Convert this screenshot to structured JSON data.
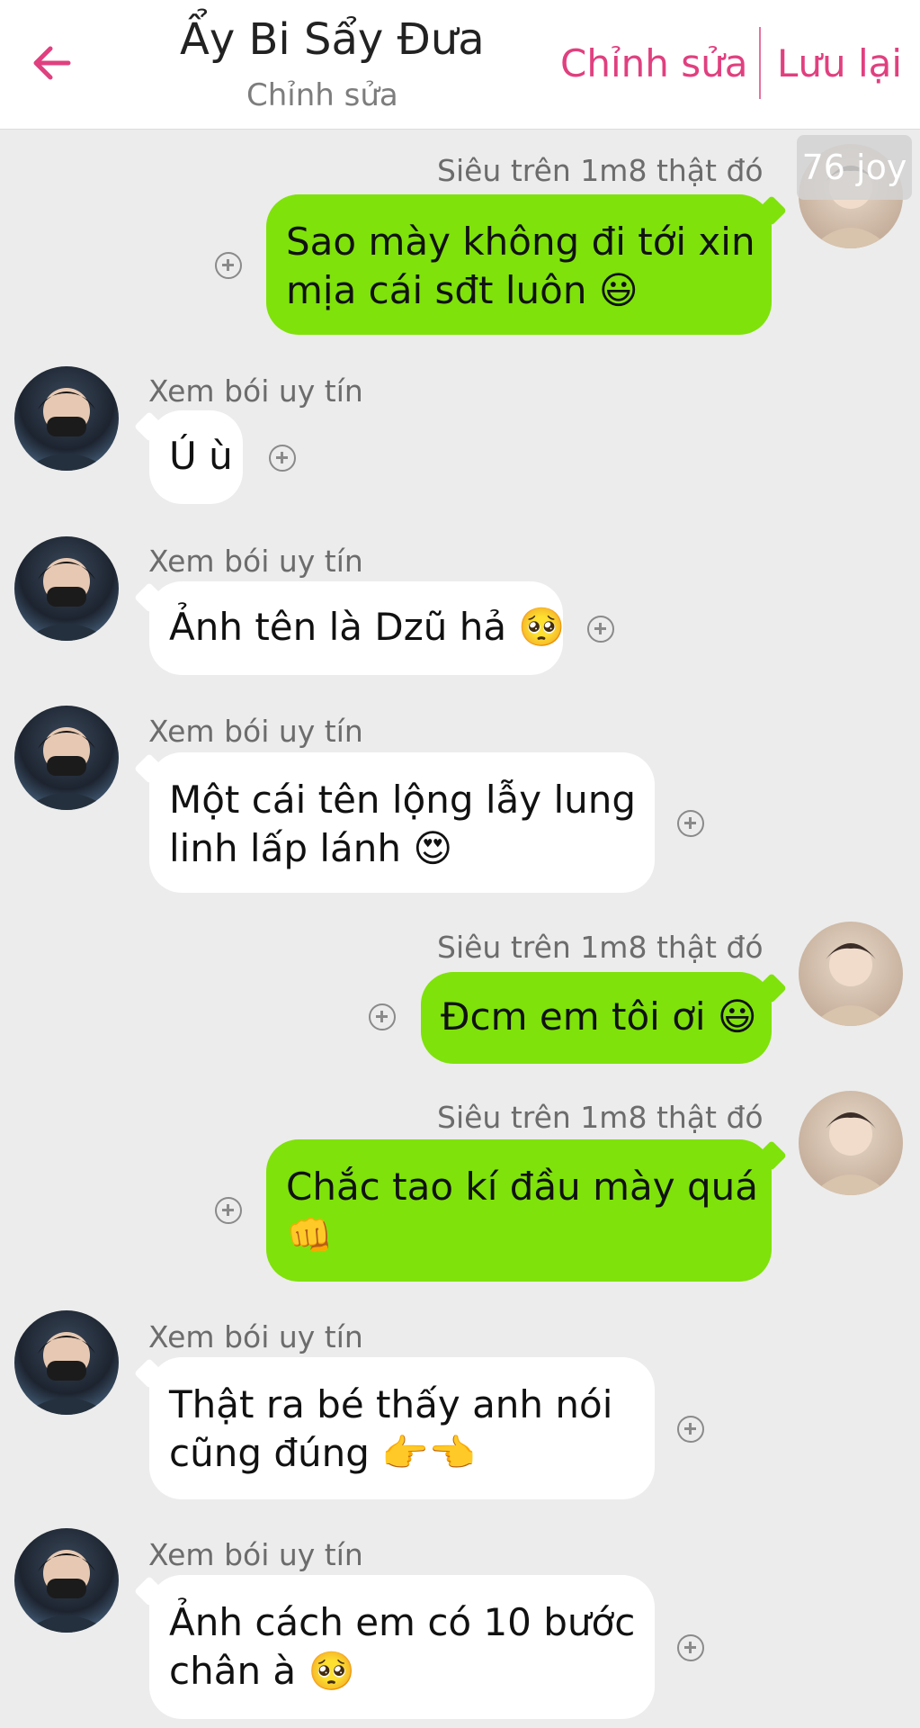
{
  "header": {
    "title": "Ẩy Bi Sẩy Đưa",
    "subtitle": "Chỉnh sửa",
    "edit_label": "Chỉnh sửa",
    "save_label": "Lưu lại",
    "accent_color": "#e0407f"
  },
  "watermark": "76 joy",
  "messages": [
    {
      "sender": "Siêu trên 1m8 thật đó",
      "line1": "Sao mày không đi tới xin",
      "line2": "mịa cái sđt luôn 😃",
      "side": "out"
    },
    {
      "sender": "Xem bói uy tín",
      "line1": "Ú ù",
      "line2": "",
      "side": "in"
    },
    {
      "sender": "Xem bói uy tín",
      "line1": "Ảnh tên là Dzũ hả 🥺",
      "line2": "",
      "side": "in"
    },
    {
      "sender": "Xem bói uy tín",
      "line1": "Một cái tên lộng lẫy lung",
      "line2": "linh lấp lánh 😍",
      "side": "in"
    },
    {
      "sender": "Siêu trên 1m8 thật đó",
      "line1": "Đcm em tôi ơi 😃",
      "line2": "",
      "side": "out"
    },
    {
      "sender": "Siêu trên 1m8 thật đó",
      "line1": "Chắc tao kí đầu mày quá",
      "line2": "👊",
      "side": "out"
    },
    {
      "sender": "Xem bói uy tín",
      "line1": "Thật ra bé thấy anh nói",
      "line2": "cũng đúng 👉👈",
      "side": "in"
    },
    {
      "sender": "Xem bói uy tín",
      "line1": "Ảnh cách em có 10 bước",
      "line2": "chân à 🥺",
      "side": "in"
    }
  ],
  "colors": {
    "incoming_bubble": "#ffffff",
    "outgoing_bubble": "#7fe20a",
    "background": "#ececec"
  }
}
